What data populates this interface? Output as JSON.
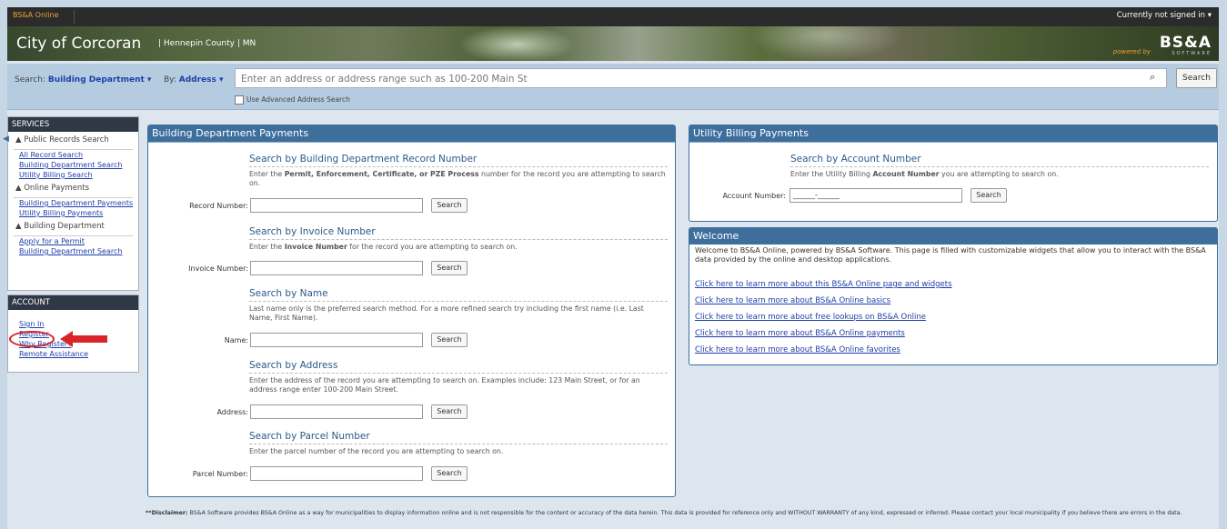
{
  "topbar": {
    "app_name": "BS&A Online",
    "signin_status": "Currently not signed in ▾"
  },
  "banner": {
    "city": "City of Corcoran",
    "county_state": "| Hennepin County | MN",
    "powered_by": "powered by",
    "logo": "BS&A",
    "logo_sub": "SOFTWARE"
  },
  "search": {
    "search_label": "Search:",
    "search_value": "Building Department ▾",
    "by_label": "By:",
    "by_value": "Address ▾",
    "placeholder": "Enter an address or address range such as 100-200 Main St",
    "button": "Search",
    "advanced": "Use Advanced Address Search"
  },
  "sidebar": {
    "services_header": "SERVICES",
    "public_records": "▲ Public Records Search",
    "all_record_search": "All Record Search",
    "building_search": "Building Department Search",
    "utility_search": "Utility Billing Search",
    "online_payments": "▲ Online Payments",
    "building_payments": "Building Department Payments",
    "utility_payments": "Utility Billing Payments",
    "building_department": "▲ Building Department",
    "apply_permit": "Apply for a Permit",
    "building_search2": "Building Department Search",
    "account_header": "ACCOUNT",
    "sign_in": "Sign In",
    "register": "Register",
    "why_register": "Why Register?",
    "remote": "Remote Assistance"
  },
  "bdp": {
    "title": "Building Department Payments",
    "record": {
      "title": "Search by Building Department Record Number",
      "desc": "Enter the Permit, Enforcement, Certificate, or PZE Process number for the record you are attempting to search on.",
      "label": "Record Number:",
      "button": "Search"
    },
    "invoice": {
      "title": "Search by Invoice Number",
      "desc": "Enter the Invoice Number for the record you are attempting to search on.",
      "label": "Invoice Number:",
      "button": "Search"
    },
    "name": {
      "title": "Search by Name",
      "desc": "Last name only is the preferred search method. For a more refined search try including the first name (i.e. Last Name, First Name).",
      "label": "Name:",
      "button": "Search"
    },
    "address": {
      "title": "Search by Address",
      "desc": "Enter the address of the record you are attempting to search on. Examples include: 123 Main Street, or for an address range enter 100-200 Main Street.",
      "label": "Address:",
      "button": "Search"
    },
    "parcel": {
      "title": "Search by Parcel Number",
      "desc": "Enter the parcel number of the record you are attempting to search on.",
      "label": "Parcel Number:",
      "button": "Search"
    }
  },
  "ubp": {
    "title": "Utility Billing Payments",
    "section_title": "Search by Account Number",
    "desc": "Enter the Utility Billing Account Number you are attempting to search on.",
    "label": "Account Number:",
    "value": "______-______",
    "button": "Search"
  },
  "welcome": {
    "title": "Welcome",
    "text": "Welcome to BS&A Online, powered by BS&A Software. This page is filled with customizable widgets that allow you to interact with the BS&A data provided by the online and desktop applications.",
    "links": [
      "Click here to learn more about this BS&A Online page and widgets",
      "Click here to learn more about BS&A Online basics",
      "Click here to learn more about free lookups on BS&A Online",
      "Click here to learn more about BS&A Online payments",
      "Click here to learn more about BS&A Online favorites"
    ]
  },
  "disclaimer": "**Disclaimer: BS&A Software provides BS&A Online as a way for municipalities to display information online and is not responsible for the content or accuracy of the data herein. This data is provided for reference only and WITHOUT WARRANTY of any kind, expressed or inferred. Please contact your local municipality if you believe there are errors in the data.",
  "colors": {
    "header_bg": "#2b2b2b",
    "panel_header": "#3d6e9c",
    "link": "#1d3fa8",
    "accent_orange": "#f0a030",
    "annotation_red": "#d9252a"
  }
}
